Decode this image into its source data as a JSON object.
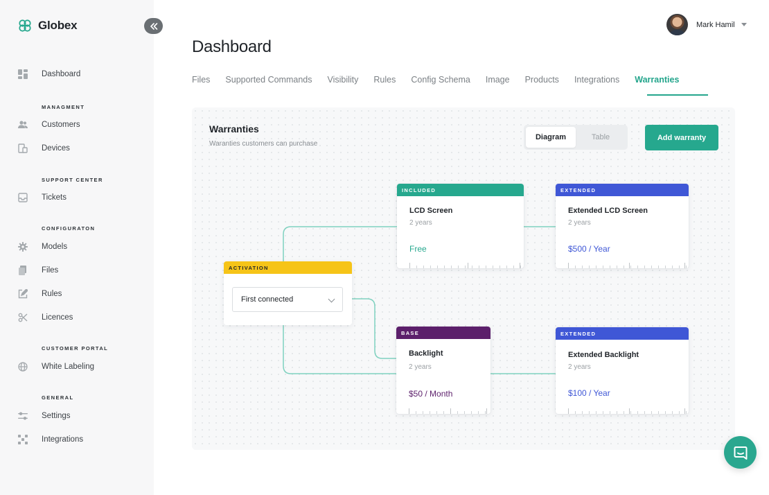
{
  "app": {
    "name": "Globex"
  },
  "user": {
    "name": "Mark Hamil"
  },
  "sidebar": {
    "dashboard": "Dashboard",
    "sections": [
      {
        "title": "MANAGMENT",
        "items": [
          "Customers",
          "Devices"
        ]
      },
      {
        "title": "SUPPORT CENTER",
        "items": [
          "Tickets"
        ]
      },
      {
        "title": "CONFIGURATON",
        "items": [
          "Models",
          "Files",
          "Rules",
          "Licences"
        ]
      },
      {
        "title": "CUSTOMER PORTAL",
        "items": [
          "White Labeling"
        ]
      },
      {
        "title": "GENERAL",
        "items": [
          "Settings",
          "Integrations"
        ]
      }
    ]
  },
  "page": {
    "title": "Dashboard"
  },
  "tabs": [
    "Files",
    "Supported Commands",
    "Visibility",
    "Rules",
    "Config Schema",
    "Image",
    "Products",
    "Integrations",
    "Warranties"
  ],
  "active_tab": "Warranties",
  "panel": {
    "title": "Warranties",
    "subtitle": "Waranties customers can purchase",
    "view_toggle": {
      "diagram": "Diagram",
      "table": "Table",
      "active": "Diagram"
    },
    "add_button": "Add warranty"
  },
  "diagram": {
    "activation": {
      "header": "ACTIVATION",
      "select_value": "First connected"
    },
    "cards": [
      {
        "header": "INCLUDED",
        "name": "LCD Screen",
        "term": "2 years",
        "price": "Free",
        "header_color": "#26a88e",
        "price_color": "#26a88e"
      },
      {
        "header": "EXTENDED",
        "name": "Extended LCD Screen",
        "term": "2 years",
        "price": "$500 / Year",
        "header_color": "#3f57d6",
        "price_color": "#3f57d6"
      },
      {
        "header": "BASE",
        "name": "Backlight",
        "term": "2 years",
        "price": "$50 / Month",
        "header_color": "#5c1f6b",
        "price_color": "#5c1f6b"
      },
      {
        "header": "EXTENDED",
        "name": "Extended Backlight",
        "term": "2 years",
        "price": "$100 / Year",
        "header_color": "#3f57d6",
        "price_color": "#3f57d6"
      }
    ]
  },
  "colors": {
    "accent": "#26a88e",
    "connector": "#7fd1bf"
  }
}
